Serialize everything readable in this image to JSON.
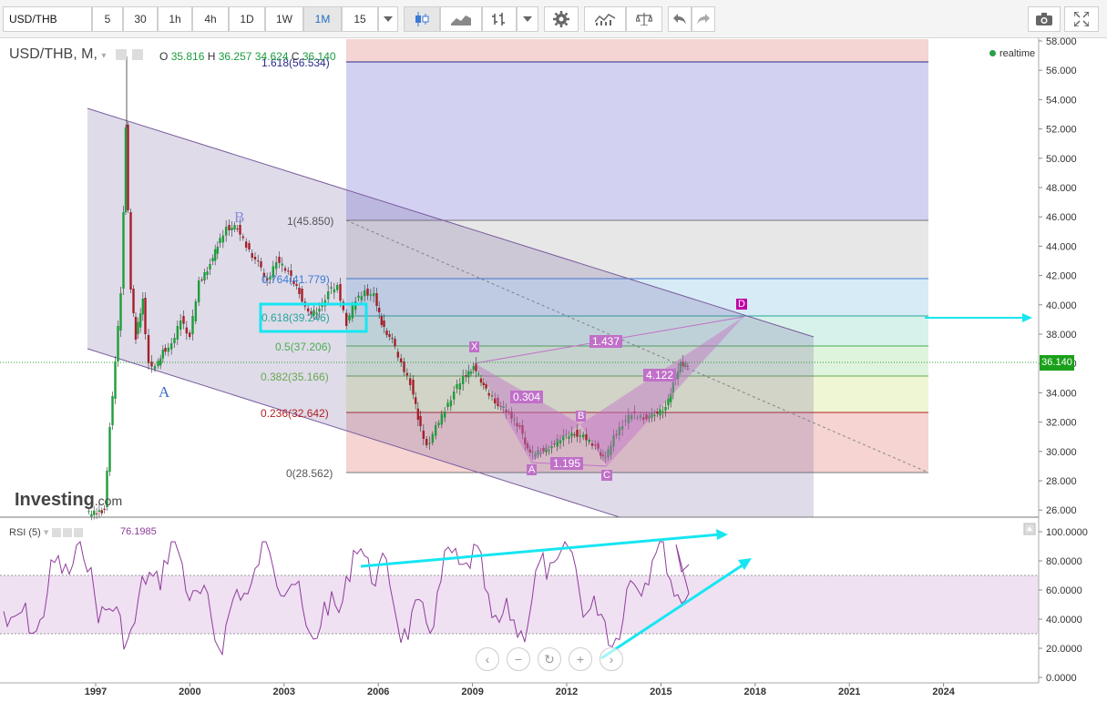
{
  "toolbar": {
    "symbol": "USD/THB",
    "intervals": [
      "5",
      "30",
      "1h",
      "4h",
      "1D",
      "1W",
      "1M",
      "15"
    ],
    "active_interval": "1M",
    "icons": [
      "candlestick-icon",
      "line-chart-icon",
      "bar-chart-icon",
      "settings-icon",
      "indicators-icon",
      "compare-icon",
      "undo-icon",
      "redo-icon",
      "camera-icon",
      "fullscreen-icon"
    ]
  },
  "header": {
    "title": "USD/THB, M,",
    "ohlc": {
      "o_label": "O",
      "o": "35.816",
      "h_label": "H",
      "h": "36.257",
      "l": "34.624",
      "c_label": "C",
      "c": "36.140"
    },
    "realtime": "realtime"
  },
  "price_tag": "36.140",
  "price_axis": [
    "58.000",
    "56.000",
    "54.000",
    "52.000",
    "50.000",
    "48.000",
    "46.000",
    "44.000",
    "42.000",
    "40.000",
    "38.000",
    "36.000",
    "34.000",
    "32.000",
    "30.000",
    "28.000",
    "26.000"
  ],
  "rsi_axis": [
    "100.0000",
    "80.0000",
    "60.0000",
    "40.0000",
    "20.0000",
    "0.0000"
  ],
  "time_axis": [
    "1997",
    "2000",
    "2003",
    "2006",
    "2009",
    "2012",
    "2015",
    "2018",
    "2021",
    "2024"
  ],
  "fib_labels": [
    "1.618(56.534)",
    "1(45.850)",
    "0.764(41.779)",
    "0.618(39.246)",
    "0.5(37.206)",
    "0.382(35.166)",
    "0.236(32.642)",
    "0(28.562)"
  ],
  "wave_labels": [
    "A",
    "B"
  ],
  "harmonic": {
    "points": [
      "X",
      "A",
      "B",
      "C",
      "D"
    ],
    "ratios": [
      "0.304",
      "1.195",
      "4.122",
      "1.437"
    ]
  },
  "rsi": {
    "label": "RSI (5)",
    "value": "76.1985"
  },
  "watermark": {
    "brand": "Investing",
    "suffix": ".com"
  },
  "colors": {
    "up": "#1f9d3a",
    "down": "#a61f2a",
    "channel": "#7a5c9f",
    "harmonic": "#c070c8",
    "cyan": "#16e6f2",
    "rsi": "#8e3c9a"
  }
}
